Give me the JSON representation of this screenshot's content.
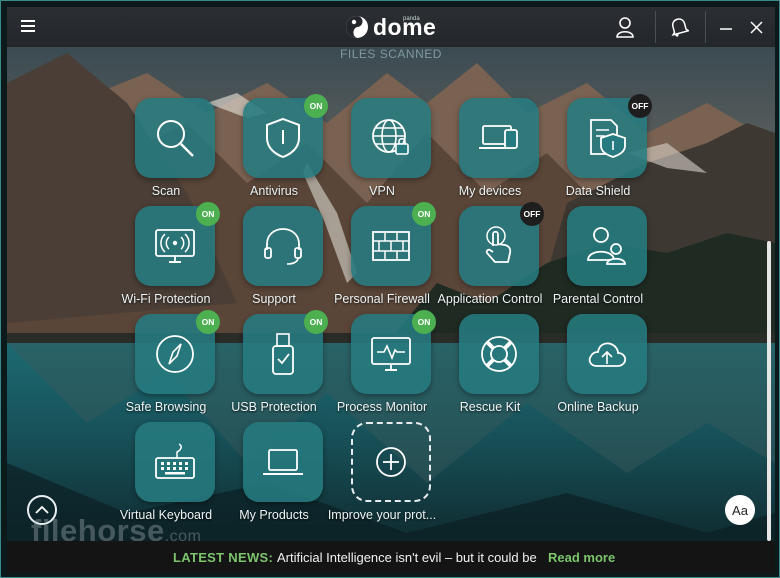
{
  "app": {
    "logo_text": "dome",
    "logo_sup": "panda"
  },
  "header": {
    "files_scanned": "FILES SCANNED"
  },
  "tiles": [
    {
      "label": "Scan",
      "badge": ""
    },
    {
      "label": "Antivirus",
      "badge": "ON"
    },
    {
      "label": "VPN",
      "badge": ""
    },
    {
      "label": "My devices",
      "badge": ""
    },
    {
      "label": "Data Shield",
      "badge": "OFF"
    },
    {
      "label": "Wi-Fi Protection",
      "badge": "ON"
    },
    {
      "label": "Support",
      "badge": ""
    },
    {
      "label": "Personal Firewall",
      "badge": "ON"
    },
    {
      "label": "Application Control",
      "badge": "OFF"
    },
    {
      "label": "Parental Control",
      "badge": ""
    },
    {
      "label": "Safe Browsing",
      "badge": "ON"
    },
    {
      "label": "USB Protection",
      "badge": "ON"
    },
    {
      "label": "Process Monitor",
      "badge": "ON"
    },
    {
      "label": "Rescue Kit",
      "badge": ""
    },
    {
      "label": "Online Backup",
      "badge": ""
    },
    {
      "label": "Virtual Keyboard",
      "badge": ""
    },
    {
      "label": "My Products",
      "badge": ""
    },
    {
      "label": "Improve your prot...",
      "badge": ""
    }
  ],
  "font_button": "Aa",
  "watermark": {
    "main": "filehorse",
    "suffix": ".com"
  },
  "news": {
    "label": "LATEST NEWS:",
    "text": "Artificial Intelligence isn't evil – but it could be",
    "link": "Read more"
  },
  "colors": {
    "tile": "#267b80",
    "badge_on": "#4caf50",
    "badge_off": "#1e1e1e",
    "news_accent": "#7cc56d",
    "titlebar": "#2b2f33"
  },
  "icons": [
    "menu-icon",
    "user-icon",
    "bell-icon",
    "minimize-icon",
    "close-icon",
    "search-icon",
    "shield-icon",
    "globe-lock-icon",
    "laptop-phone-icon",
    "document-shield-icon",
    "monitor-wifi-icon",
    "headset-icon",
    "brick-wall-icon",
    "touch-hand-icon",
    "parent-child-icon",
    "compass-icon",
    "usb-drive-icon",
    "monitor-pulse-icon",
    "lifebuoy-icon",
    "cloud-upload-icon",
    "keyboard-icon",
    "laptop-icon",
    "plus-circle-icon",
    "chevron-up-icon"
  ]
}
